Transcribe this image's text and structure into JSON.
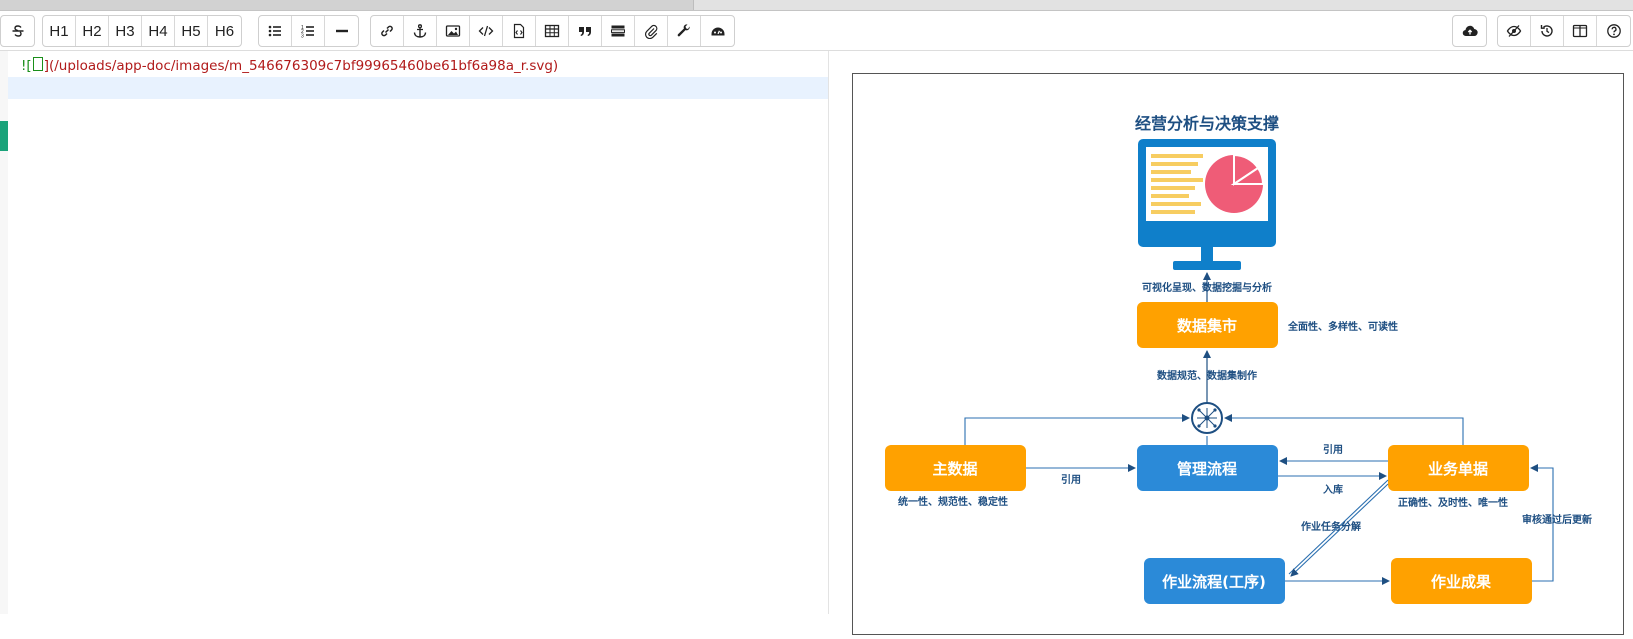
{
  "tabs": [
    {
      "label": ""
    },
    {
      "label": ""
    }
  ],
  "toolbar": {
    "strikethrough_icon": "strikethrough-icon",
    "headings": [
      "H1",
      "H2",
      "H3",
      "H4",
      "H5",
      "H6"
    ],
    "list_icons": [
      "unordered-list-icon",
      "ordered-list-icon",
      "horizontal-rule-icon"
    ],
    "insert_icons": [
      "link-icon",
      "anchor-icon",
      "image-icon",
      "code-icon",
      "code-block-icon",
      "table-icon",
      "quote-icon",
      "html-entity-icon",
      "attachment-icon",
      "tools-icon",
      "emoji-icon"
    ],
    "right_icons": [
      "save-cloud-icon",
      "toggle-preview-icon",
      "history-icon",
      "split-view-icon",
      "help-icon"
    ]
  },
  "editor": {
    "bang": "![",
    "alt_box": "",
    "path": "](/uploads/app-doc/images/m_546676309c7bf99965460be61bf6a98a_r.svg)"
  },
  "diagram": {
    "title": "经营分析与决策支撑",
    "nodes": {
      "data_mart": "数据集市",
      "master_data": "主数据",
      "mgmt_process": "管理流程",
      "biz_docs": "业务单据",
      "work_process": "作业流程(工序)",
      "work_result": "作业成果"
    },
    "labels": {
      "visualize": "可视化呈现、数据挖掘与分析",
      "mart_props": "全面性、多样性、可读性",
      "standardize": "数据规范、数据集制作",
      "ref_left": "引用",
      "ref_right": "引用",
      "storage": "入库",
      "master_props": "统一性、规范性、稳定性",
      "biz_props": "正确性、及时性、唯一性",
      "task_decompose": "作业任务分解",
      "audit_update": "审核通过后更新"
    },
    "colors": {
      "orange": "#ffa100",
      "blue": "#2b8ad8",
      "navy": "#1e4f82",
      "monitor": "#0f7fca",
      "pie": "#ef5c77",
      "bars": "#f7cd61"
    }
  }
}
